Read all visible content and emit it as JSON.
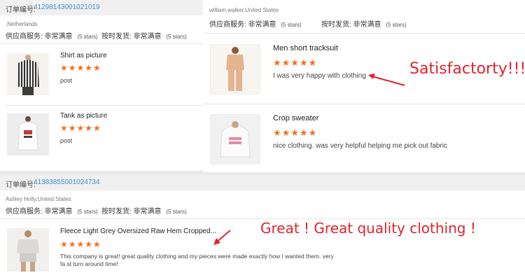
{
  "order1": {
    "label": "订单编号:",
    "number": "41298143001021019",
    "buyer": ",Netherlands",
    "supplier_service": "供应商服务: 非常满意",
    "supplier_rating": "(5 stars)",
    "shipping": "按时发货: 非常满意",
    "shipping_rating": "(5 stars)",
    "items": [
      {
        "title": "Shirt as picture",
        "stars": "★★★★★",
        "comment": "post"
      },
      {
        "title": "Tank as picture",
        "stars": "★★★★★",
        "comment": "post"
      }
    ]
  },
  "review_panel": {
    "buyer": "william walker,United States",
    "supplier_service": "供应商服务: 非常满意",
    "supplier_rating": "(5 stars)",
    "shipping": "按时发货: 非常满意",
    "shipping_rating": "(5 stars)",
    "items": [
      {
        "title": "Men short tracksuit",
        "stars": "★★★★★",
        "comment": "I was very happy with clothing"
      },
      {
        "title": "Crop sweater",
        "stars": "★★★★★",
        "comment": "nice clothing. was very helpful helping me pick out fabric"
      }
    ],
    "annotation": "Satisfactorty!!!"
  },
  "order2": {
    "label": "订单编号:",
    "number": "41383855001024734",
    "buyer": "Ashley Holly,United States",
    "supplier_service": "供应商服务: 非常满意",
    "supplier_rating": "(5 stars)",
    "shipping": "按时发货: 非常满意",
    "shipping_rating": "(5 stars)",
    "item": {
      "title": "Fleece Light Grey Oversized Raw Hem Cropped...",
      "stars": "★★★★★",
      "comment": "This company is great! great quality clothing and my pieces were made exactly how I wanted them. very fa st turn around time!"
    },
    "annotation": "Great ! Great quality clothing !"
  },
  "icons": [
    "striped-shirt-image",
    "white-tank-image",
    "tracksuit-image",
    "hoodie-image",
    "fleece-set-image",
    "arrow-icon"
  ],
  "colors": {
    "star": "#f0701f",
    "order_number": "#3a8fd8",
    "annotation": "#e0242c"
  }
}
